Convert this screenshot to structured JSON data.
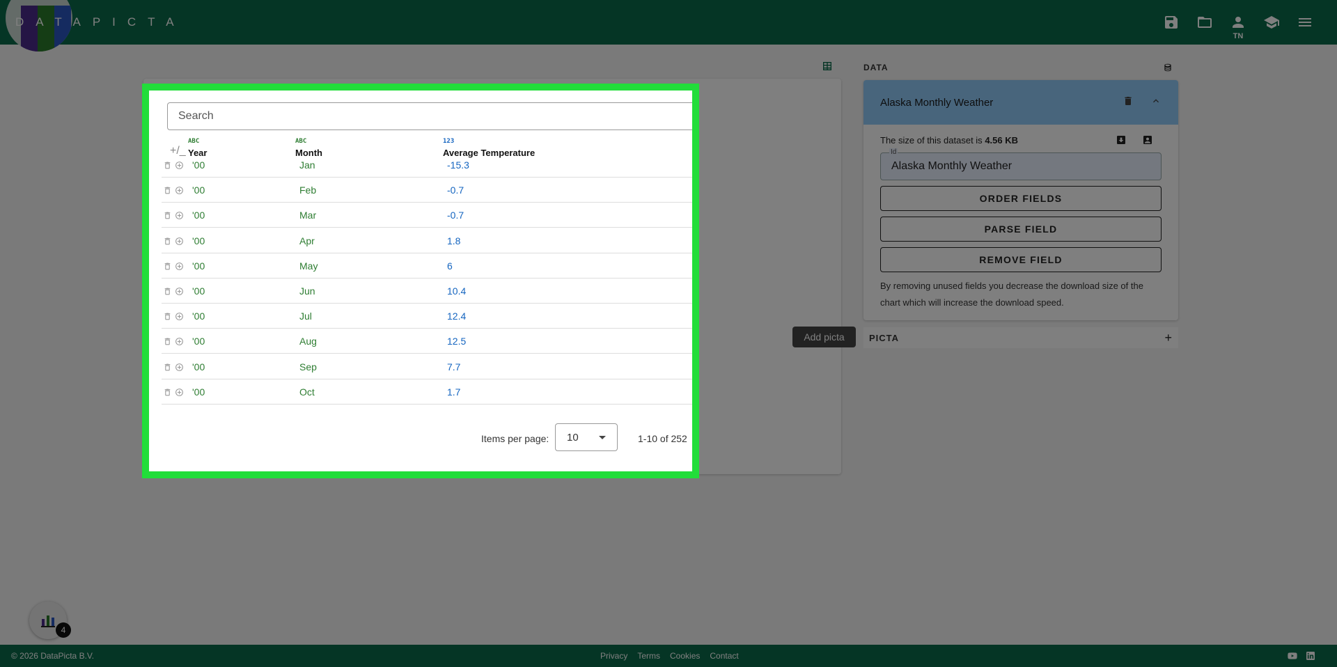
{
  "header": {
    "logo_text": "DATAPICTA",
    "logo_colors": [
      "#4a2a8a",
      "#2b7a2b",
      "#2a56c0"
    ],
    "icons": [
      "save-icon",
      "folder-open-icon",
      "account-icon",
      "school-icon",
      "menu-icon"
    ],
    "user_initials": "TN"
  },
  "search": {
    "placeholder": "Search"
  },
  "table": {
    "plusminus": "+/_",
    "columns": [
      {
        "type": "ABC",
        "label": "Year",
        "type_color": "#2e7d32"
      },
      {
        "type": "ABC",
        "label": "Month",
        "type_color": "#2e7d32"
      },
      {
        "type": "123",
        "label": "Average Temperature",
        "type_color": "#1565c0"
      }
    ],
    "rows": [
      {
        "year": "'00",
        "month": "Jan",
        "temp": "-15.3"
      },
      {
        "year": "'00",
        "month": "Feb",
        "temp": "-0.7"
      },
      {
        "year": "'00",
        "month": "Mar",
        "temp": "-0.7"
      },
      {
        "year": "'00",
        "month": "Apr",
        "temp": "1.8"
      },
      {
        "year": "'00",
        "month": "May",
        "temp": "6"
      },
      {
        "year": "'00",
        "month": "Jun",
        "temp": "10.4"
      },
      {
        "year": "'00",
        "month": "Jul",
        "temp": "12.4"
      },
      {
        "year": "'00",
        "month": "Aug",
        "temp": "12.5"
      },
      {
        "year": "'00",
        "month": "Sep",
        "temp": "7.7"
      },
      {
        "year": "'00",
        "month": "Oct",
        "temp": "1.7"
      }
    ],
    "paginator": {
      "items_per_page_label": "Items per page:",
      "items_per_page_value": "10",
      "range": "1-10 of 252"
    }
  },
  "tooltip": "Add picta",
  "panel": {
    "data_title": "DATA",
    "dataset_name": "Alaska Monthly Weather",
    "size_prefix": "The size of this dataset is",
    "size_value": "4.56 KB",
    "id_label": "Id",
    "id_value": "Alaska Monthly Weather",
    "buttons": [
      "ORDER FIELDS",
      "PARSE FIELD",
      "REMOVE FIELD"
    ],
    "note": "By removing unused fields you decrease the download size of the chart which will increase the download speed.",
    "picta_title": "PICTA",
    "picta_add": "+",
    "header_color": "#90caf9"
  },
  "fab": {
    "badge": "4"
  },
  "footer": {
    "copyright": "© 2026 DataPicta B.V.",
    "links": [
      "Privacy",
      "Terms",
      "Cookies",
      "Contact"
    ]
  },
  "colors": {
    "brand": "#0b6b4a",
    "highlight": "#22dd3a"
  }
}
